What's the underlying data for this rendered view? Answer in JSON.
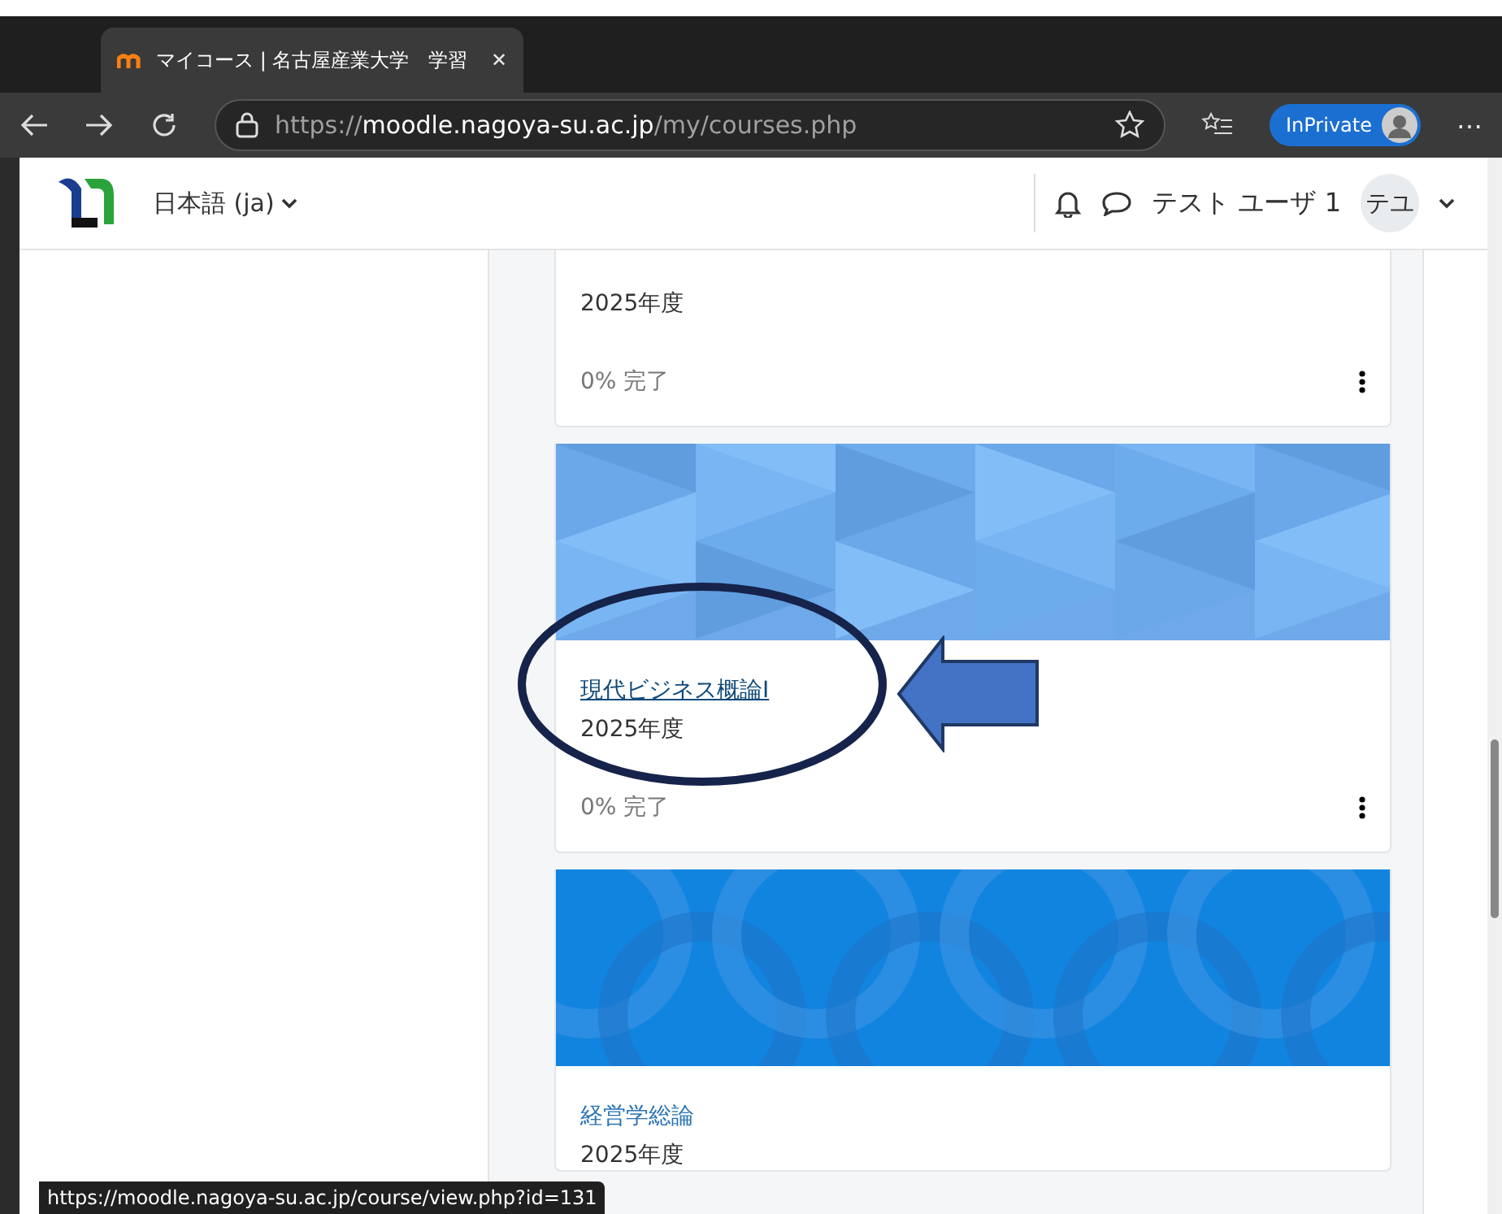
{
  "browser": {
    "tab_title": "マイコース | 名古屋産業大学　学習",
    "tab_close": "✕",
    "more": "⋯",
    "url": {
      "scheme": "https://",
      "host": "moodle.nagoya-su.ac.jp",
      "path": "/my/courses.php"
    },
    "profile_label": "InPrivate"
  },
  "header": {
    "language": "日本語 (ja)",
    "user_name": "テスト ユーザ 1",
    "avatar_initials": "テユ"
  },
  "courses": [
    {
      "year": "2025年度",
      "progress": "0% 完了"
    },
    {
      "kind": "triangles",
      "title": "現代ビジネス概論Ⅰ",
      "hovered": true,
      "year": "2025年度",
      "progress": "0% 完了"
    },
    {
      "kind": "circles",
      "title": "経営学総論",
      "hovered": false,
      "year": "2025年度"
    }
  ],
  "status_url": "https://moodle.nagoya-su.ac.jp/course/view.php?id=131"
}
